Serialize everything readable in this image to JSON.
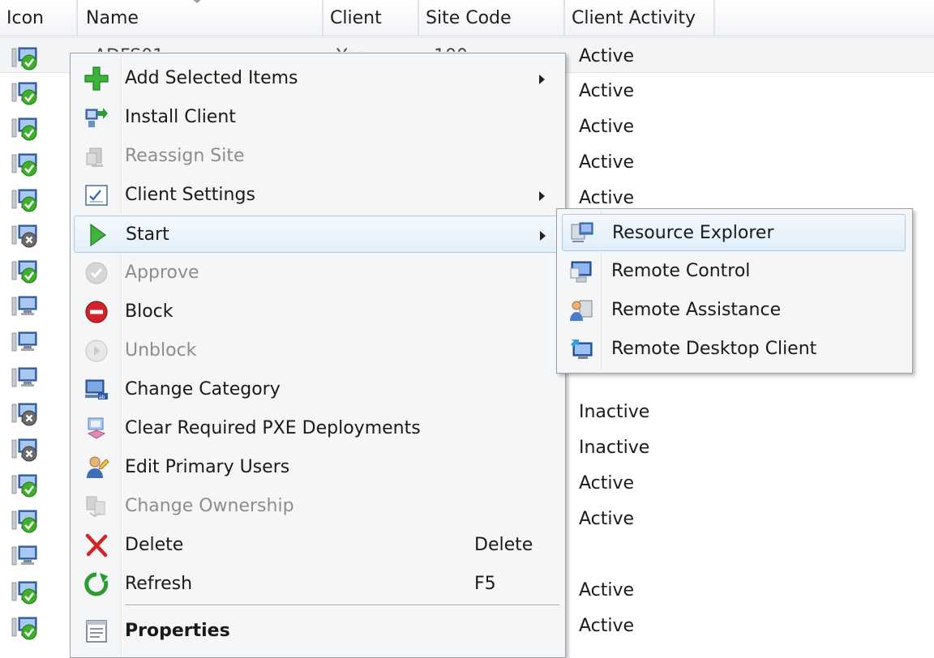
{
  "columns": {
    "icon": "Icon",
    "name": "Name",
    "client": "Client",
    "site_code": "Site Code",
    "client_activity": "Client Activity"
  },
  "first_row": {
    "name_partial": "ADFS01",
    "client_partial": "Yes",
    "site_partial": "100"
  },
  "rows": [
    {
      "status": "ok",
      "activity": "Active"
    },
    {
      "status": "ok",
      "activity": "Active"
    },
    {
      "status": "ok",
      "activity": "Active"
    },
    {
      "status": "ok",
      "activity": "Active"
    },
    {
      "status": "ok",
      "activity": "Active"
    },
    {
      "status": "x",
      "activity": ""
    },
    {
      "status": "ok",
      "activity": ""
    },
    {
      "status": "plain",
      "activity": ""
    },
    {
      "status": "plain",
      "activity": ""
    },
    {
      "status": "plain",
      "activity": ""
    },
    {
      "status": "x",
      "activity": "Inactive"
    },
    {
      "status": "x",
      "activity": "Inactive"
    },
    {
      "status": "ok",
      "activity": "Active"
    },
    {
      "status": "ok",
      "activity": "Active"
    },
    {
      "status": "plain",
      "activity": ""
    },
    {
      "status": "ok",
      "activity": "Active"
    },
    {
      "status": "ok",
      "activity": "Active"
    }
  ],
  "context_menu": {
    "items": [
      {
        "label": "Add Selected Items",
        "icon": "add-plus-icon",
        "submenu": true
      },
      {
        "label": "Install Client",
        "icon": "install-client-icon"
      },
      {
        "label": "Reassign Site",
        "icon": "reassign-site-icon",
        "disabled": true
      },
      {
        "label": "Client Settings",
        "icon": "client-settings-icon",
        "submenu": true
      },
      {
        "label": "Start",
        "icon": "start-play-icon",
        "submenu": true,
        "highlighted": true
      },
      {
        "label": "Approve",
        "icon": "approve-check-icon",
        "disabled": true
      },
      {
        "label": "Block",
        "icon": "block-icon"
      },
      {
        "label": "Unblock",
        "icon": "unblock-icon",
        "disabled": true
      },
      {
        "label": "Change Category",
        "icon": "change-category-icon"
      },
      {
        "label": "Clear Required PXE Deployments",
        "icon": "clear-pxe-icon"
      },
      {
        "label": "Edit Primary Users",
        "icon": "edit-primary-users-icon"
      },
      {
        "label": "Change Ownership",
        "icon": "change-ownership-icon",
        "disabled": true
      },
      {
        "label": "Delete",
        "icon": "delete-x-icon",
        "shortcut": "Delete"
      },
      {
        "label": "Refresh",
        "icon": "refresh-icon",
        "shortcut": "F5"
      },
      {
        "label": "Properties",
        "icon": "properties-icon",
        "bold": true
      }
    ]
  },
  "start_submenu": {
    "items": [
      {
        "label": "Resource Explorer",
        "icon": "resource-explorer-icon",
        "highlighted": true
      },
      {
        "label": "Remote Control",
        "icon": "remote-control-icon"
      },
      {
        "label": "Remote Assistance",
        "icon": "remote-assistance-icon"
      },
      {
        "label": "Remote Desktop Client",
        "icon": "remote-desktop-icon"
      }
    ]
  },
  "colors": {
    "accent_highlight": "#e3eff9",
    "highlight_border": "#a9cbe7",
    "ok_green": "#3fae2a",
    "x_gray": "#6b6b6b",
    "block_red": "#d2232a",
    "delete_red": "#d0262b"
  }
}
